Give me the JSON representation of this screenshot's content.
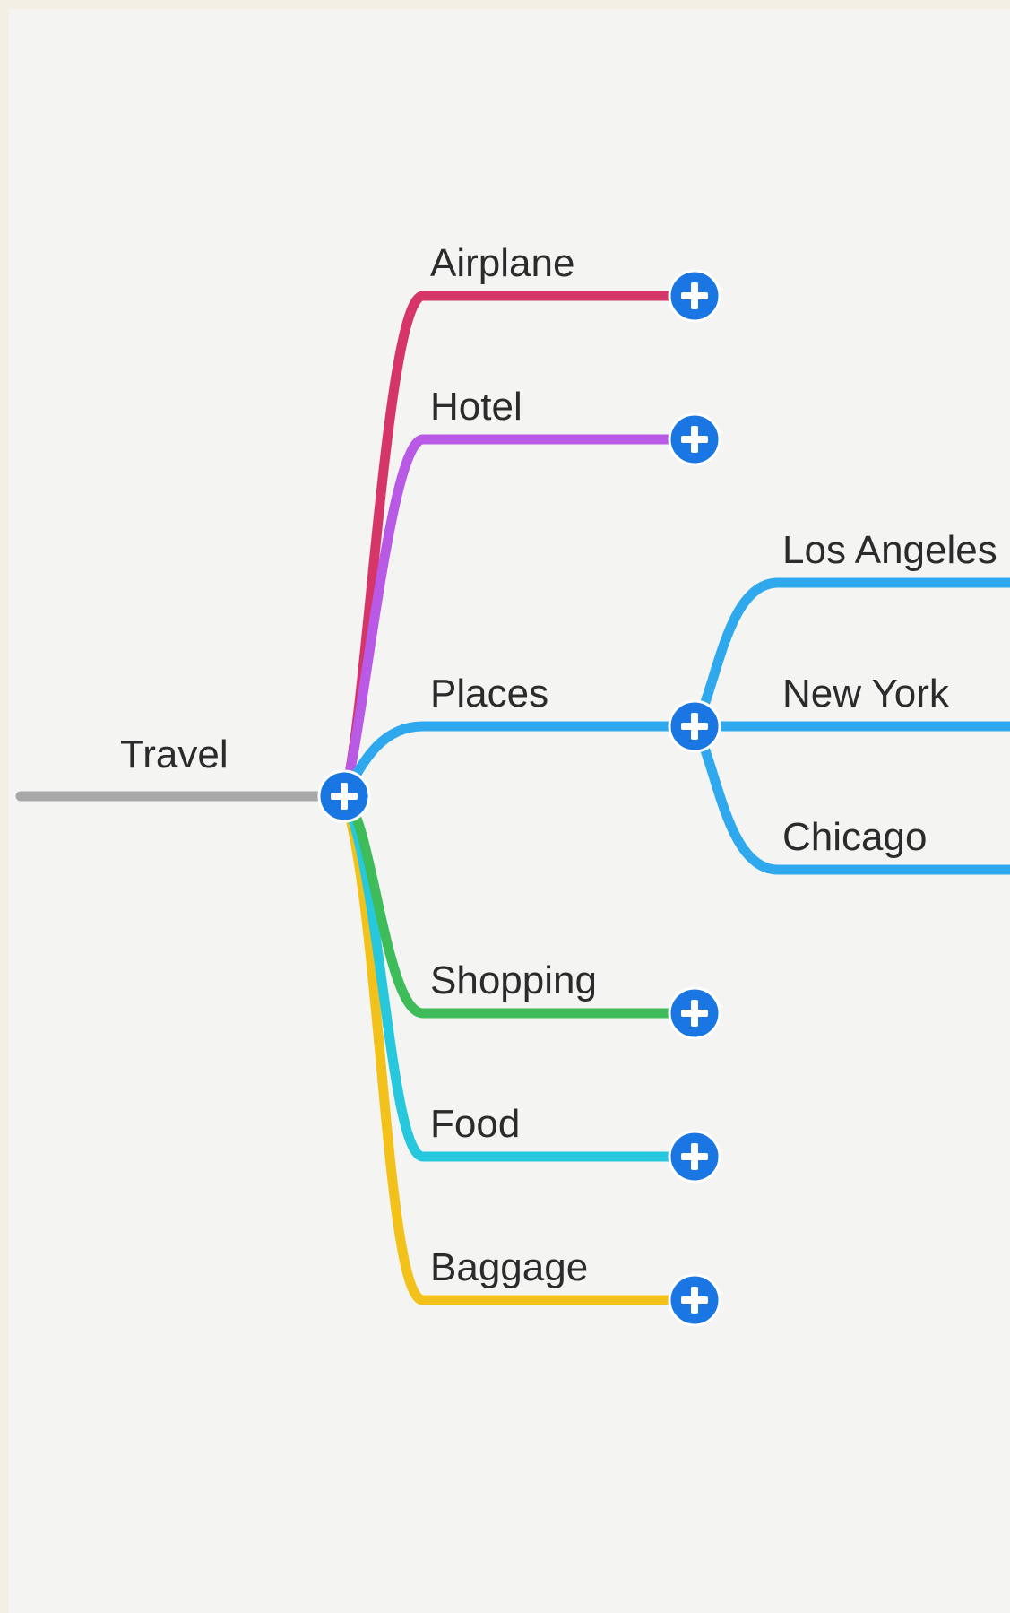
{
  "mindmap": {
    "root": {
      "label": "Travel",
      "color": "#a8a8a8"
    },
    "add_button_color": "#1976e3",
    "branches": [
      {
        "label": "Airplane",
        "color": "#d63667"
      },
      {
        "label": "Hotel",
        "color": "#b85ae6"
      },
      {
        "label": "Places",
        "color": "#2fa8ee"
      },
      {
        "label": "Shopping",
        "color": "#3fbc5a"
      },
      {
        "label": "Food",
        "color": "#27c8dd"
      },
      {
        "label": "Baggage",
        "color": "#f2c21b"
      }
    ],
    "places_children": [
      {
        "label": "Los Angeles"
      },
      {
        "label": "New York"
      },
      {
        "label": "Chicago"
      }
    ]
  }
}
